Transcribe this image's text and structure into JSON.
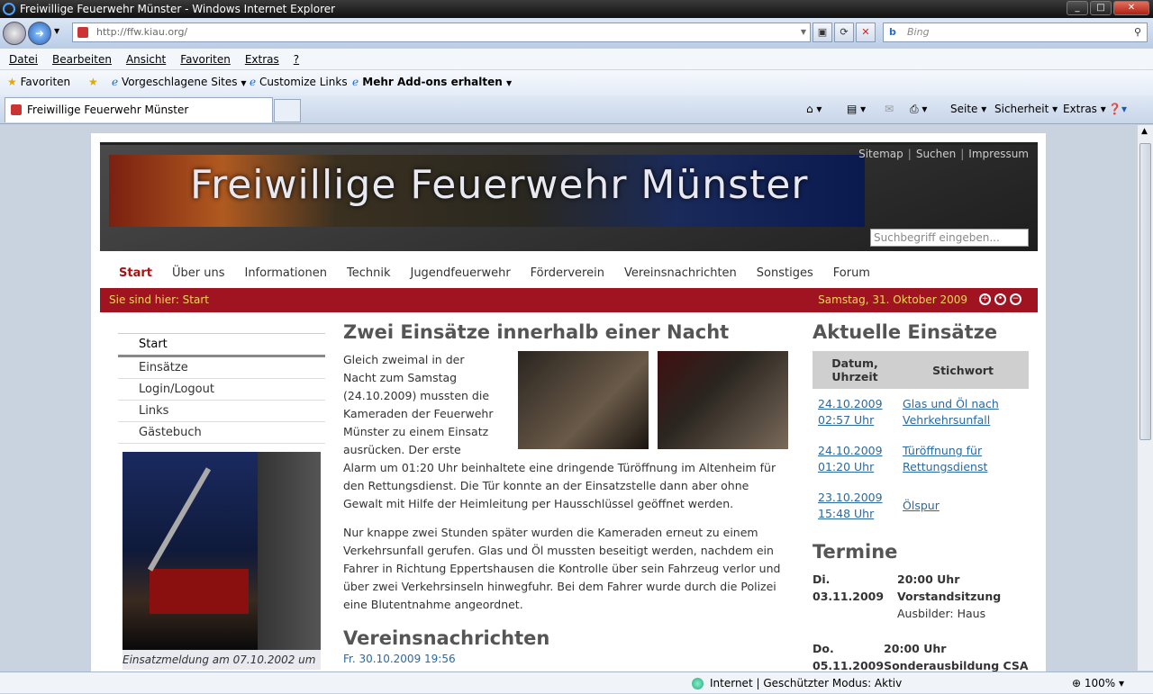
{
  "window": {
    "title": "Freiwillige Feuerwehr Münster - Windows Internet Explorer"
  },
  "browser": {
    "address": "http://ffw.kiau.org/",
    "search_placeholder": "Bing",
    "menu": [
      "Datei",
      "Bearbeiten",
      "Ansicht",
      "Favoriten",
      "Extras",
      "?"
    ],
    "favorites": {
      "favoriten": "Favoriten",
      "vorgeschlagen": "Vorgeschlagene Sites",
      "customize": "Customize Links",
      "addons": "Mehr Add-ons erhalten"
    },
    "tab_title": "Freiwillige Feuerwehr Münster",
    "commands": {
      "seite": "Seite",
      "sicherheit": "Sicherheit",
      "extras": "Extras"
    },
    "status": {
      "zone": "Internet | Geschützter Modus: Aktiv",
      "zoom": "100%"
    }
  },
  "site": {
    "banner_title": "Freiwillige Feuerwehr Münster",
    "toplinks": {
      "sitemap": "Sitemap",
      "suchen": "Suchen",
      "impressum": "Impressum"
    },
    "search_placeholder": "Suchbegriff eingeben...",
    "nav": [
      "Start",
      "Über uns",
      "Informationen",
      "Technik",
      "Jugendfeuerwehr",
      "Förderverein",
      "Vereinsnachrichten",
      "Sonstiges",
      "Forum"
    ],
    "breadcrumb": "Sie sind hier: Start",
    "date": "Samstag, 31. Oktober 2009",
    "sidenav": {
      "head": "Start",
      "items": [
        "Einsätze",
        "Login/Logout",
        "Links",
        "Gästebuch"
      ]
    },
    "side_caption": "Einsatzmeldung am 07.10.2002 um"
  },
  "article": {
    "title": "Zwei Einsätze innerhalb einer Nacht",
    "p1": "Gleich zweimal in der Nacht zum Samstag (24.10.2009) mussten die Kameraden der Feuerwehr Münster zu einem Einsatz ausrücken. Der erste Alarm um 01:20 Uhr beinhaltete eine dringende Türöffnung im Altenheim für den Rettungsdienst. Die Tür konnte an der Einsatzstelle dann aber ohne Gewalt mit Hilfe der Heimleitung per Hausschlüssel geöffnet werden.",
    "p2": "Nur knappe zwei Stunden später wurden die Kameraden erneut zu einem Verkehrsunfall gerufen. Glas und Öl mussten beseitigt werden, nachdem ein Fahrer in Richtung Eppertshausen die Kontrolle über sein Fahrzeug verlor und über zwei Verkehrsinseln hinwegfuhr. Bei dem Fahrer wurde durch die Polizei eine Blutentnahme angeordnet.",
    "news_title": "Vereinsnachrichten",
    "news_date": "Fr. 30.10.2009 19:56"
  },
  "einsaetze": {
    "title": "Aktuelle Einsätze",
    "col_date": "Datum, Uhrzeit",
    "col_stichwort": "Stichwort",
    "rows": [
      {
        "date": "24.10.2009",
        "time": "02:57 Uhr",
        "stichwort": "Glas und Öl nach Vehrkehrsunfall"
      },
      {
        "date": "24.10.2009",
        "time": "01:20 Uhr",
        "stichwort": "Türöffnung für Rettungsdienst"
      },
      {
        "date": "23.10.2009",
        "time": "15:48 Uhr",
        "stichwort": "Ölspur"
      }
    ]
  },
  "termine": {
    "title": "Termine",
    "items": [
      {
        "day": "Di.",
        "date": "03.11.2009",
        "time": "20:00 Uhr",
        "name": "Vorstandsitzung",
        "extra": "Ausbilder: Haus"
      },
      {
        "day": "Do.",
        "date": "05.11.2009",
        "time": "20:00 Uhr",
        "name": "Sonderausbildung CSA -",
        "extra": ""
      }
    ]
  }
}
